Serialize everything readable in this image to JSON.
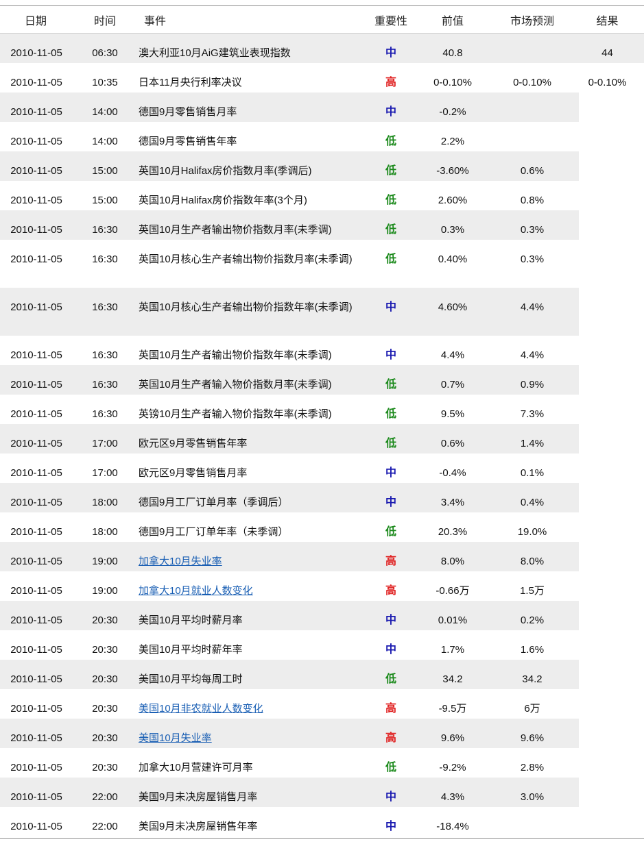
{
  "header": {
    "date": "日期",
    "time": "时间",
    "event": "事件",
    "importance": "重要性",
    "previous": "前值",
    "forecast": "市场预测",
    "result": "结果"
  },
  "colors": {
    "high": "#e02020",
    "mid": "#1a1ab0",
    "low": "#1c8a1c",
    "link": "#1a5fb4",
    "stripe": "#ededed"
  },
  "rows": [
    {
      "date": "2010-11-05",
      "time": "06:30",
      "event": "澳大利亚10月AiG建筑业表现指数",
      "importance": "中",
      "level": "mid",
      "previous": "40.8",
      "forecast": "",
      "result": "44",
      "link": false,
      "h": 43,
      "shade": "full"
    },
    {
      "date": "2010-11-05",
      "time": "10:35",
      "event": "日本11月央行利率决议",
      "importance": "高",
      "level": "high",
      "previous": "0-0.10%",
      "forecast": "0-0.10%",
      "result": "0-0.10%",
      "link": false,
      "h": 43,
      "shade": "none"
    },
    {
      "date": "2010-11-05",
      "time": "14:00",
      "event": "德国9月零售销售月率",
      "importance": "中",
      "level": "mid",
      "previous": "-0.2%",
      "forecast": "",
      "result": "",
      "link": false,
      "h": 43,
      "shade": "part"
    },
    {
      "date": "2010-11-05",
      "time": "14:00",
      "event": "德国9月零售销售年率",
      "importance": "低",
      "level": "low",
      "previous": "2.2%",
      "forecast": "",
      "result": "",
      "link": false,
      "h": 43,
      "shade": "none"
    },
    {
      "date": "2010-11-05",
      "time": "15:00",
      "event": "英国10月Halifax房价指数月率(季调后)",
      "importance": "低",
      "level": "low",
      "previous": "-3.60%",
      "forecast": "0.6%",
      "result": "",
      "link": false,
      "h": 43,
      "shade": "part"
    },
    {
      "date": "2010-11-05",
      "time": "15:00",
      "event": "英国10月Halifax房价指数年率(3个月)",
      "importance": "低",
      "level": "low",
      "previous": "2.60%",
      "forecast": "0.8%",
      "result": "",
      "link": false,
      "h": 43,
      "shade": "none"
    },
    {
      "date": "2010-11-05",
      "time": "16:30",
      "event": "英国10月生产者输出物价指数月率(未季调)",
      "importance": "低",
      "level": "low",
      "previous": "0.3%",
      "forecast": "0.3%",
      "result": "",
      "link": false,
      "h": 43,
      "shade": "part"
    },
    {
      "date": "2010-11-05",
      "time": "16:30",
      "event": "英国10月核心生产者输出物价指数月率(未季调)",
      "importance": "低",
      "level": "low",
      "previous": "0.40%",
      "forecast": "0.3%",
      "result": "",
      "link": false,
      "h": 70,
      "shade": "none"
    },
    {
      "date": "2010-11-05",
      "time": "16:30",
      "event": "英国10月核心生产者输出物价指数年率(未季调)",
      "importance": "中",
      "level": "mid",
      "previous": "4.60%",
      "forecast": "4.4%",
      "result": "",
      "link": false,
      "h": 70,
      "shade": "part"
    },
    {
      "date": "2010-11-05",
      "time": "16:30",
      "event": "英国10月生产者输出物价指数年率(未季调)",
      "importance": "中",
      "level": "mid",
      "previous": "4.4%",
      "forecast": "4.4%",
      "result": "",
      "link": false,
      "h": 43,
      "shade": "none"
    },
    {
      "date": "2010-11-05",
      "time": "16:30",
      "event": "英国10月生产者输入物价指数月率(未季调)",
      "importance": "低",
      "level": "low",
      "previous": "0.7%",
      "forecast": "0.9%",
      "result": "",
      "link": false,
      "h": 43,
      "shade": "part"
    },
    {
      "date": "2010-11-05",
      "time": "16:30",
      "event": "英镑10月生产者输入物价指数年率(未季调)",
      "importance": "低",
      "level": "low",
      "previous": "9.5%",
      "forecast": "7.3%",
      "result": "",
      "link": false,
      "h": 43,
      "shade": "none"
    },
    {
      "date": "2010-11-05",
      "time": "17:00",
      "event": "欧元区9月零售销售年率",
      "importance": "低",
      "level": "low",
      "previous": "0.6%",
      "forecast": "1.4%",
      "result": "",
      "link": false,
      "h": 43,
      "shade": "part"
    },
    {
      "date": "2010-11-05",
      "time": "17:00",
      "event": "欧元区9月零售销售月率",
      "importance": "中",
      "level": "mid",
      "previous": "-0.4%",
      "forecast": "0.1%",
      "result": "",
      "link": false,
      "h": 43,
      "shade": "none"
    },
    {
      "date": "2010-11-05",
      "time": "18:00",
      "event": "德国9月工厂订单月率（季调后）",
      "importance": "中",
      "level": "mid",
      "previous": "3.4%",
      "forecast": "0.4%",
      "result": "",
      "link": false,
      "h": 43,
      "shade": "part"
    },
    {
      "date": "2010-11-05",
      "time": "18:00",
      "event": "德国9月工厂订单年率（未季调）",
      "importance": "低",
      "level": "low",
      "previous": "20.3%",
      "forecast": "19.0%",
      "result": "",
      "link": false,
      "h": 43,
      "shade": "none"
    },
    {
      "date": "2010-11-05",
      "time": "19:00",
      "event": "加拿大10月失业率",
      "importance": "高",
      "level": "high",
      "previous": "8.0%",
      "forecast": "8.0%",
      "result": "",
      "link": true,
      "h": 43,
      "shade": "part"
    },
    {
      "date": "2010-11-05",
      "time": "19:00",
      "event": "加拿大10月就业人数变化",
      "importance": "高",
      "level": "high",
      "previous": "-0.66万",
      "forecast": "1.5万",
      "result": "",
      "link": true,
      "h": 43,
      "shade": "none"
    },
    {
      "date": "2010-11-05",
      "time": "20:30",
      "event": "美国10月平均时薪月率",
      "importance": "中",
      "level": "mid",
      "previous": "0.01%",
      "forecast": "0.2%",
      "result": "",
      "link": false,
      "h": 43,
      "shade": "part"
    },
    {
      "date": "2010-11-05",
      "time": "20:30",
      "event": "美国10月平均时薪年率",
      "importance": "中",
      "level": "mid",
      "previous": "1.7%",
      "forecast": "1.6%",
      "result": "",
      "link": false,
      "h": 43,
      "shade": "none"
    },
    {
      "date": "2010-11-05",
      "time": "20:30",
      "event": "美国10月平均每周工时",
      "importance": "低",
      "level": "low",
      "previous": "34.2",
      "forecast": "34.2",
      "result": "",
      "link": false,
      "h": 43,
      "shade": "part"
    },
    {
      "date": "2010-11-05",
      "time": "20:30",
      "event": "美国10月非农就业人数变化",
      "importance": "高",
      "level": "high",
      "previous": "-9.5万",
      "forecast": "6万",
      "result": "",
      "link": true,
      "h": 43,
      "shade": "none"
    },
    {
      "date": "2010-11-05",
      "time": "20:30",
      "event": "美国10月失业率",
      "importance": "高",
      "level": "high",
      "previous": "9.6%",
      "forecast": "9.6%",
      "result": "",
      "link": true,
      "h": 43,
      "shade": "part"
    },
    {
      "date": "2010-11-05",
      "time": "20:30",
      "event": "加拿大10月营建许可月率",
      "importance": "低",
      "level": "low",
      "previous": "-9.2%",
      "forecast": "2.8%",
      "result": "",
      "link": false,
      "h": 43,
      "shade": "none"
    },
    {
      "date": "2010-11-05",
      "time": "22:00",
      "event": "美国9月未决房屋销售月率",
      "importance": "中",
      "level": "mid",
      "previous": "4.3%",
      "forecast": "3.0%",
      "result": "",
      "link": false,
      "h": 43,
      "shade": "part"
    },
    {
      "date": "2010-11-05",
      "time": "22:00",
      "event": "美国9月未决房屋销售年率",
      "importance": "中",
      "level": "mid",
      "previous": "-18.4%",
      "forecast": "",
      "result": "",
      "link": false,
      "h": 45,
      "shade": "none"
    }
  ]
}
